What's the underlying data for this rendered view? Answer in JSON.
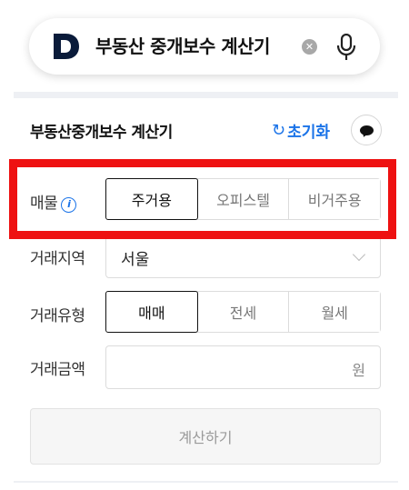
{
  "search": {
    "query": "부동산 중개보수 계산기",
    "clear_symbol": "✕"
  },
  "header": {
    "title": "부동산중개보수 계산기",
    "reset_label": "초기화",
    "reset_icon": "↻"
  },
  "rows": {
    "property": {
      "label": "매물",
      "info_symbol": "i",
      "options": [
        "주거용",
        "오피스텔",
        "비거주용"
      ],
      "selected": "주거용"
    },
    "region": {
      "label": "거래지역",
      "value": "서울"
    },
    "deal_type": {
      "label": "거래유형",
      "options": [
        "매매",
        "전세",
        "월세"
      ],
      "selected": "매매"
    },
    "amount": {
      "label": "거래금액",
      "unit": "원"
    }
  },
  "calculate_label": "계산하기",
  "colors": {
    "accent": "#1a73e8",
    "highlight": "#ee1111"
  }
}
